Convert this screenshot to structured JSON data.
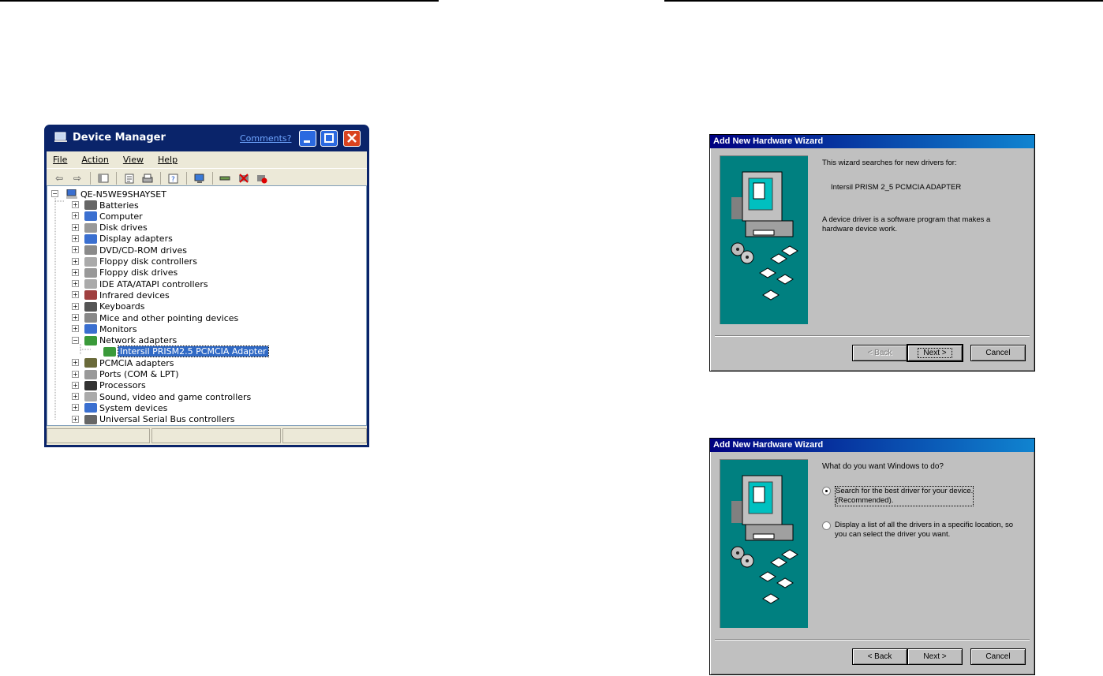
{
  "device_manager": {
    "title": "Device Manager",
    "comments_link": "Comments?",
    "menu": [
      "File",
      "Action",
      "View",
      "Help"
    ],
    "toolbar_icons": [
      "back-icon",
      "forward-icon",
      "show-hide-tree-icon",
      "properties-icon",
      "print-icon",
      "help-icon",
      "scan-hardware-icon",
      "update-driver-icon",
      "uninstall-icon",
      "disable-icon"
    ],
    "root": "QE-N5WE9SHAYSET",
    "categories": [
      "Batteries",
      "Computer",
      "Disk drives",
      "Display adapters",
      "DVD/CD-ROM drives",
      "Floppy disk controllers",
      "Floppy disk drives",
      "IDE ATA/ATAPI controllers",
      "Infrared devices",
      "Keyboards",
      "Mice and other pointing devices",
      "Monitors",
      "Network adapters",
      "PCMCIA adapters",
      "Ports (COM & LPT)",
      "Processors",
      "Sound, video and game controllers",
      "System devices",
      "Universal Serial Bus controllers"
    ],
    "selected_device": "Intersil PRISM2.5 PCMCIA Adapter",
    "colors": {
      "title_bar": "#0a246a",
      "selection": "#316ac5",
      "body": "#ece9d8"
    }
  },
  "wizard1": {
    "title": "Add New Hardware Wizard",
    "line1": "This wizard searches for new drivers for:",
    "device": "Intersil PRISM 2_5 PCMCIA ADAPTER",
    "line2": "A device driver is a software program that makes a hardware device work.",
    "back": "< Back",
    "next": "Next >",
    "cancel": "Cancel"
  },
  "wizard2": {
    "title": "Add New Hardware Wizard",
    "question": "What do you want Windows to do?",
    "option1_line1": "Search for the best driver for your device.",
    "option1_line2": "(Recommended).",
    "option2": "Display a list of all the drivers in a specific location, so you can select the driver you want.",
    "selected_option": 1,
    "back": "< Back",
    "next": "Next >",
    "cancel": "Cancel",
    "colors": {
      "title_gradient_start": "#000080",
      "panel": "#008080"
    }
  }
}
